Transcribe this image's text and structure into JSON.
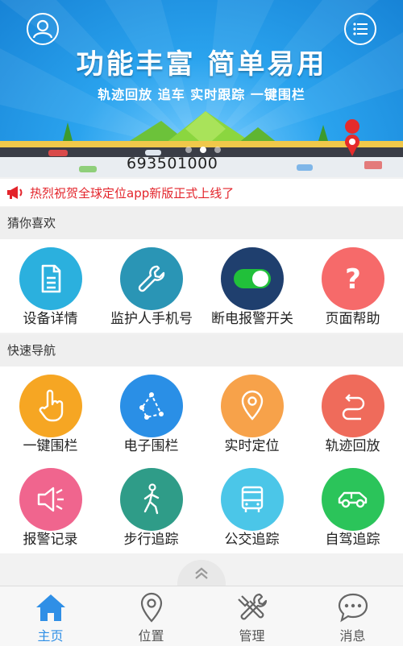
{
  "banner": {
    "headline": "功能丰富 简单易用",
    "subline": "轨迹回放 追车 实时跟踪 一键围栏",
    "number": "693501000",
    "slides_total": 3,
    "slide_active": 1
  },
  "announcement": {
    "text": "热烈祝贺全球定位app新版正式上线了"
  },
  "sections": {
    "favorites_title": "猜你喜欢",
    "quicknav_title": "快速导航"
  },
  "favorites": [
    {
      "label": "设备详情",
      "icon": "document-icon",
      "color": "#2bb0de"
    },
    {
      "label": "监护人手机号",
      "icon": "wrench-icon",
      "color": "#2a95b5"
    },
    {
      "label": "断电报警开关",
      "icon": "toggle-icon",
      "color": "#1f3f6e"
    },
    {
      "label": "页面帮助",
      "icon": "question-icon",
      "color": "#f66a6a"
    }
  ],
  "quicknav": [
    {
      "label": "一键围栏",
      "icon": "hand-pointer-icon",
      "color": "#f6a623"
    },
    {
      "label": "电子围栏",
      "icon": "polygon-fence-icon",
      "color": "#2a8fe6"
    },
    {
      "label": "实时定位",
      "icon": "location-pin-icon",
      "color": "#f7a24a"
    },
    {
      "label": "轨迹回放",
      "icon": "replay-arrow-icon",
      "color": "#ef6b5b"
    },
    {
      "label": "报警记录",
      "icon": "speaker-icon",
      "color": "#f0658e"
    },
    {
      "label": "步行追踪",
      "icon": "walking-person-icon",
      "color": "#2f9c88"
    },
    {
      "label": "公交追踪",
      "icon": "bus-icon",
      "color": "#4bc6e8"
    },
    {
      "label": "自驾追踪",
      "icon": "car-icon",
      "color": "#2bc45a"
    }
  ],
  "tabbar": {
    "active": "home",
    "items": [
      {
        "key": "home",
        "label": "主页",
        "icon": "home-icon"
      },
      {
        "key": "location",
        "label": "位置",
        "icon": "location-pin-icon"
      },
      {
        "key": "manage",
        "label": "管理",
        "icon": "tools-icon"
      },
      {
        "key": "messages",
        "label": "消息",
        "icon": "chat-bubble-icon"
      }
    ]
  },
  "colors": {
    "accent": "#2f8fe6",
    "announcement": "#e3242b",
    "banner": "#2aa3ee"
  }
}
